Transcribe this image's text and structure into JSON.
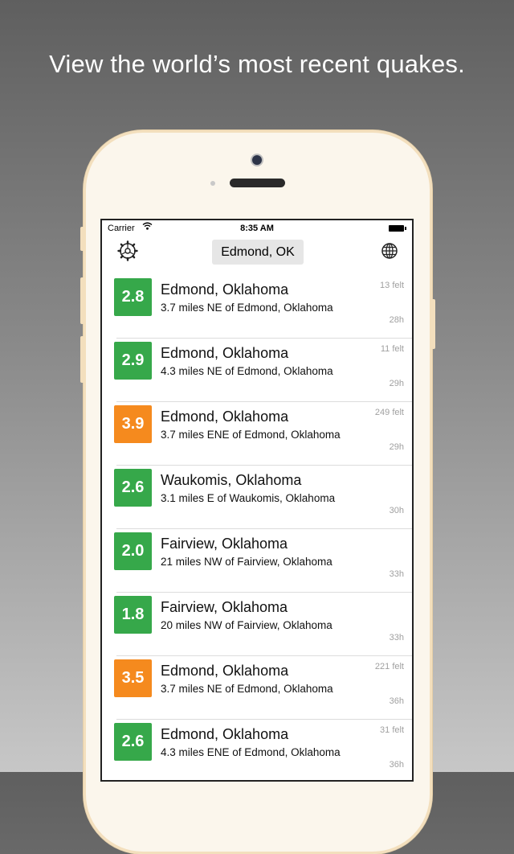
{
  "headline": "View the world’s most recent quakes.",
  "status_bar": {
    "carrier": "Carrier",
    "time": "8:35 AM"
  },
  "nav": {
    "location": "Edmond, OK"
  },
  "colors": {
    "green": "#36a84a",
    "orange": "#f58a1e"
  },
  "quakes": [
    {
      "magnitude": "2.8",
      "color": "green",
      "place": "Edmond, Oklahoma",
      "detail": "3.7 miles NE of Edmond, Oklahoma",
      "felt": "13 felt",
      "age": "28h"
    },
    {
      "magnitude": "2.9",
      "color": "green",
      "place": "Edmond, Oklahoma",
      "detail": "4.3 miles NE of Edmond, Oklahoma",
      "felt": "11 felt",
      "age": "29h"
    },
    {
      "magnitude": "3.9",
      "color": "orange",
      "place": "Edmond, Oklahoma",
      "detail": "3.7 miles ENE of Edmond, Oklahoma",
      "felt": "249 felt",
      "age": "29h"
    },
    {
      "magnitude": "2.6",
      "color": "green",
      "place": "Waukomis, Oklahoma",
      "detail": "3.1 miles E of Waukomis, Oklahoma",
      "felt": "",
      "age": "30h"
    },
    {
      "magnitude": "2.0",
      "color": "green",
      "place": "Fairview, Oklahoma",
      "detail": "21 miles NW of Fairview, Oklahoma",
      "felt": "",
      "age": "33h"
    },
    {
      "magnitude": "1.8",
      "color": "green",
      "place": "Fairview, Oklahoma",
      "detail": "20 miles NW of Fairview, Oklahoma",
      "felt": "",
      "age": "33h"
    },
    {
      "magnitude": "3.5",
      "color": "orange",
      "place": "Edmond, Oklahoma",
      "detail": "3.7 miles NE of Edmond, Oklahoma",
      "felt": "221 felt",
      "age": "36h"
    },
    {
      "magnitude": "2.6",
      "color": "green",
      "place": "Edmond, Oklahoma",
      "detail": "4.3 miles ENE of Edmond, Oklahoma",
      "felt": "31 felt",
      "age": "36h"
    }
  ]
}
